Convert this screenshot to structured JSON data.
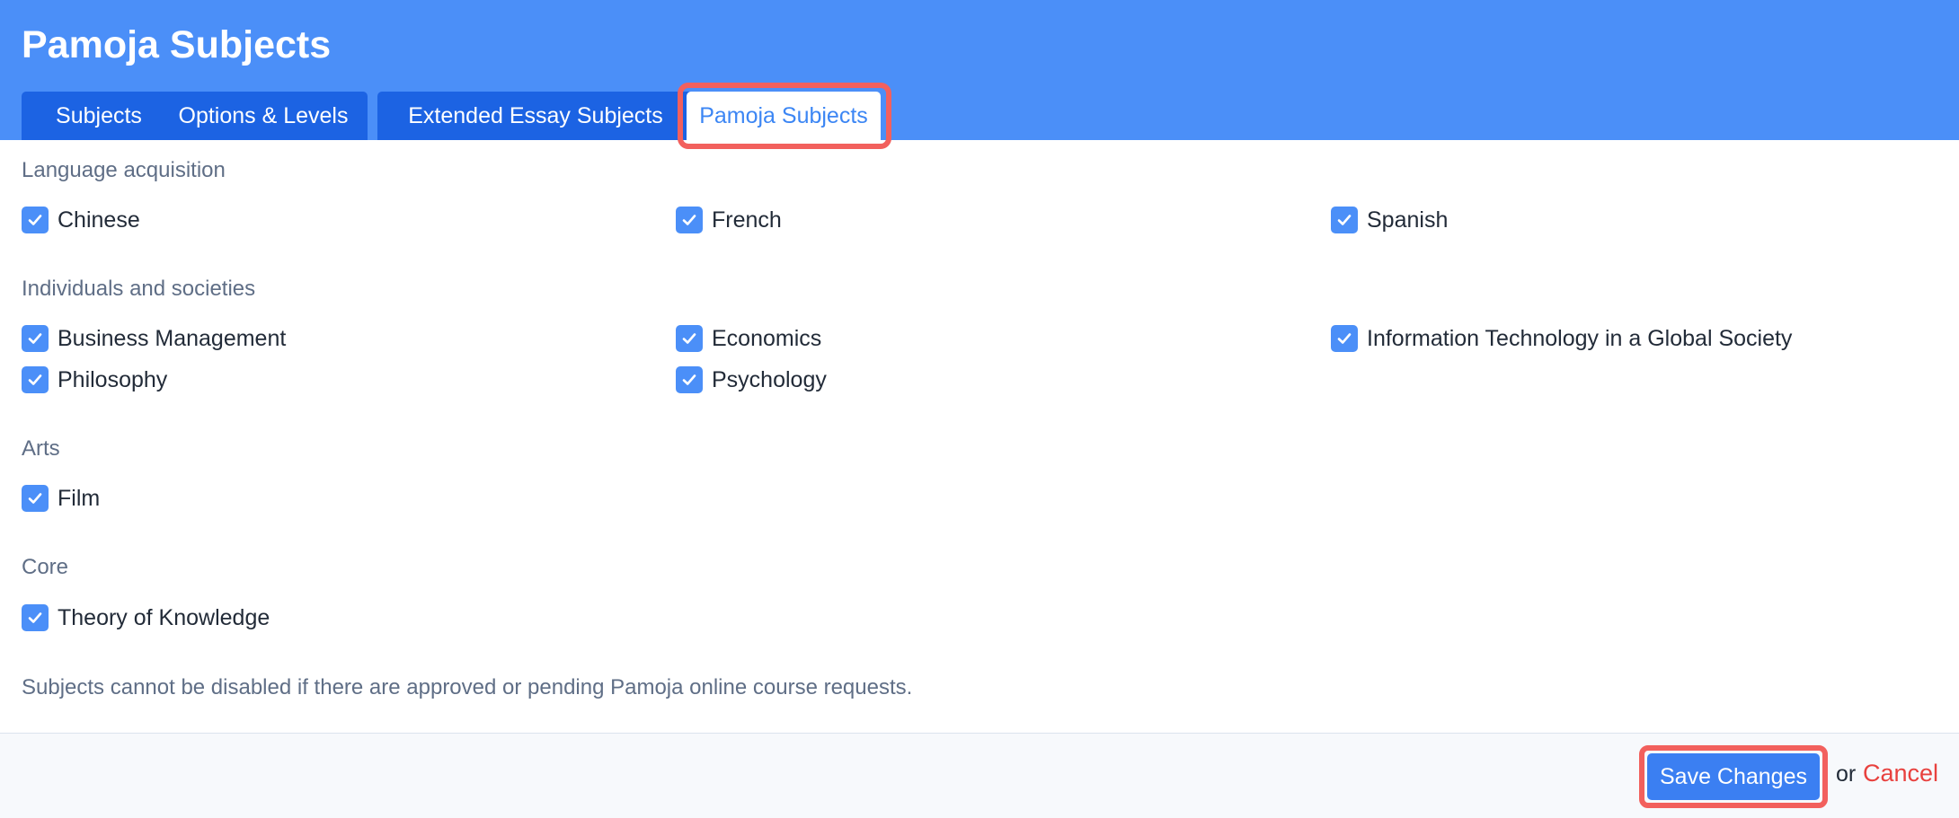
{
  "header": {
    "title": "Pamoja Subjects",
    "tabs": [
      {
        "label": "Subjects",
        "active": false
      },
      {
        "label": "Options & Levels",
        "active": false
      },
      {
        "label": "Extended Essay Subjects",
        "active": false
      },
      {
        "label": "Pamoja Subjects",
        "active": true
      }
    ]
  },
  "sections": [
    {
      "heading": "Language acquisition",
      "items": [
        {
          "label": "Chinese",
          "checked": true
        },
        {
          "label": "French",
          "checked": true
        },
        {
          "label": "Spanish",
          "checked": true
        }
      ]
    },
    {
      "heading": "Individuals and societies",
      "items": [
        {
          "label": "Business Management",
          "checked": true
        },
        {
          "label": "Economics",
          "checked": true
        },
        {
          "label": "Information Technology in a Global Society",
          "checked": true
        },
        {
          "label": "Philosophy",
          "checked": true
        },
        {
          "label": "Psychology",
          "checked": true
        }
      ]
    },
    {
      "heading": "Arts",
      "items": [
        {
          "label": "Film",
          "checked": true
        }
      ]
    },
    {
      "heading": "Core",
      "items": [
        {
          "label": "Theory of Knowledge",
          "checked": true
        }
      ]
    }
  ],
  "note": "Subjects cannot be disabled if there are approved or pending Pamoja online course requests.",
  "footer": {
    "save_label": "Save Changes",
    "or_text": "or",
    "cancel_label": "Cancel"
  },
  "colors": {
    "header_bg": "#4b8ff8",
    "tab_bg": "#1c63e3",
    "checkbox": "#4b8ff8",
    "highlight": "#f2605d",
    "cancel": "#e8413e"
  },
  "icons": {
    "checkbox": "checkmark-icon"
  }
}
